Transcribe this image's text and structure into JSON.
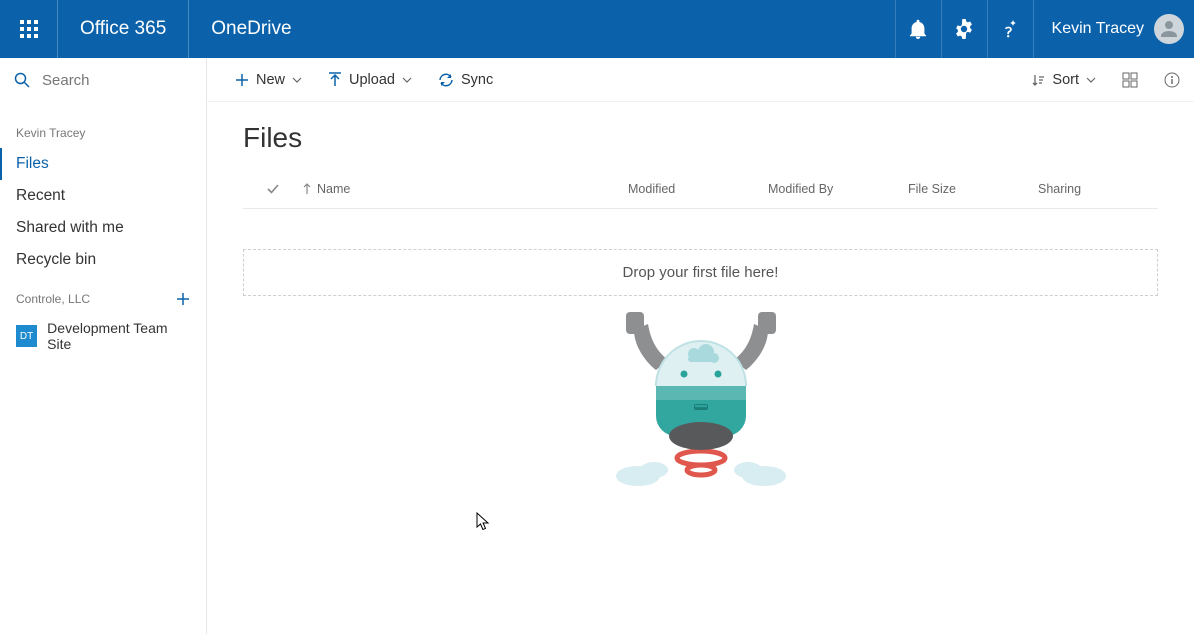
{
  "header": {
    "suite": "Office 365",
    "app": "OneDrive",
    "user": "Kevin Tracey"
  },
  "search": {
    "placeholder": "Search"
  },
  "sidebar": {
    "owner": "Kevin Tracey",
    "items": [
      {
        "label": "Files",
        "active": true
      },
      {
        "label": "Recent"
      },
      {
        "label": "Shared with me"
      },
      {
        "label": "Recycle bin"
      }
    ],
    "org_label": "Controle, LLC",
    "site": {
      "badge": "DT",
      "name": "Development Team Site"
    }
  },
  "commands": {
    "new": "New",
    "upload": "Upload",
    "sync": "Sync",
    "sort": "Sort"
  },
  "page": {
    "title": "Files",
    "columns": {
      "name": "Name",
      "modified": "Modified",
      "modified_by": "Modified By",
      "size": "File Size",
      "sharing": "Sharing"
    },
    "drop_hint": "Drop your first file here!"
  }
}
